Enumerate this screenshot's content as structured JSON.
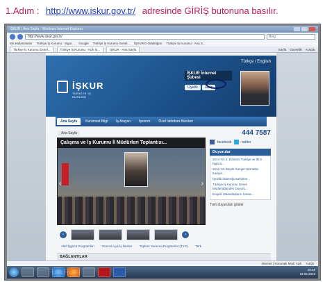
{
  "instruction": {
    "step": "1.Adım :",
    "url": "http://www.iskur.gov.tr/",
    "text": "adresinde GİRİŞ butonuna basılır."
  },
  "browser": {
    "window_title": "İŞKUR | Ana Sayfa - Windows Internet Explorer",
    "address": "http://www.iskur.gov.tr/",
    "search_placeholder": "Bing",
    "favorites_label": "Sık Kullanılanlar",
    "favorites": [
      "Türkiye İş Kurumu - Sigor...",
      "Google",
      "Türkiye İş Kurumu Genel...",
      "İŞKUR E-Ortaklığım",
      "Türkiye İş Kurumu - Ana S..."
    ],
    "tabs": [
      "Türkiye İş Kurumu Genel...",
      "Türkiye İş Kurumu - Açık İş...",
      "İŞKUR - Ana Sayfa"
    ],
    "tools": [
      "Sayfa",
      "Güvenlik",
      "Araçlar"
    ],
    "status": "Internet | Korumalı Mod: Açık",
    "zoom": "%100"
  },
  "site": {
    "lang": "Türkçe / English",
    "logo_name": "İŞKUR",
    "logo_sub": "TÜRKİYE İŞ KURUMU",
    "branch_title": "İŞKUR İnternet Şubesi",
    "branch_buttons": [
      "Üyelik",
      "Giriş"
    ],
    "menu": [
      "Ana Sayfa",
      "Kurumsal Bilgi",
      "İş Arayan",
      "İşveren",
      "Özel İstihdam Büroları"
    ],
    "breadcrumb": "Ana Sayfa",
    "slider_caption": "Çalışma ve İş Kurumu İl Müdürleri Toplantısı...",
    "bottom_links": [
      "Aktif İşgücü Programları",
      "Güncel Açık İş İlanları",
      "Toplum Yararına Programlar (TYP)",
      "Türk"
    ],
    "hotline": "444 7587",
    "social": [
      "facebook",
      "twitter"
    ],
    "announcements_title": "Duyurular",
    "announcements": [
      "2014 Yılı 3. Dönemi Türkiye ve İlk 8 İşgücü...",
      "2016 Yılı Büyük Sosyal Hizmetler Kariyer...",
      "İşsizlik Ödeneği Sahipleri...",
      "Türkiye İş Kurumu Genel Müdürlüğünden Duyuru...",
      "Engelli Vatandaşların Sınavı..."
    ],
    "all_announcements": "Tüm duyuruları göster",
    "links_section": "BAĞLANTILAR"
  },
  "taskbar": {
    "time": "10:19",
    "date": "18.05.2015"
  }
}
